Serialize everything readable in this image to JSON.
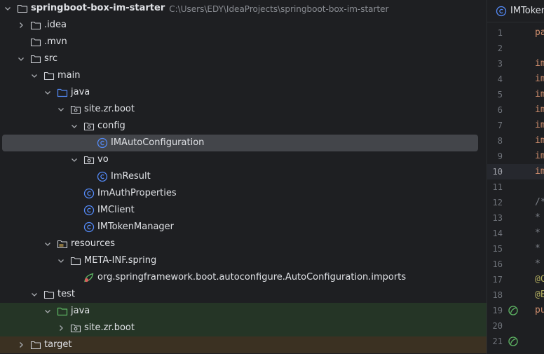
{
  "project_tree": {
    "root_name": "springboot-box-im-starter",
    "root_path": "C:\\Users\\EDY\\IdeaProjects\\springboot-box-im-starter",
    "items": [
      {
        "label": ".idea",
        "icon": "folder-icon"
      },
      {
        "label": ".mvn",
        "icon": "folder-icon"
      },
      {
        "label": "src",
        "icon": "folder-icon"
      },
      {
        "label": "main",
        "icon": "folder-icon"
      },
      {
        "label": "java",
        "icon": "source-folder-icon"
      },
      {
        "label": "site.zr.boot",
        "icon": "package-icon"
      },
      {
        "label": "config",
        "icon": "package-icon"
      },
      {
        "label": "IMAutoConfiguration",
        "icon": "class-icon",
        "selected": true
      },
      {
        "label": "vo",
        "icon": "package-icon"
      },
      {
        "label": "ImResult",
        "icon": "class-icon"
      },
      {
        "label": "ImAuthProperties",
        "icon": "class-icon"
      },
      {
        "label": "IMClient",
        "icon": "class-icon"
      },
      {
        "label": "IMTokenManager",
        "icon": "class-icon"
      },
      {
        "label": "resources",
        "icon": "resources-folder-icon"
      },
      {
        "label": "META-INF.spring",
        "icon": "folder-icon"
      },
      {
        "label": "org.springframework.boot.autoconfigure.AutoConfiguration.imports",
        "icon": "spring-imports-file-icon"
      },
      {
        "label": "test",
        "icon": "folder-icon"
      },
      {
        "label": "java",
        "icon": "test-source-folder-icon"
      },
      {
        "label": "site.zr.boot",
        "icon": "package-icon"
      },
      {
        "label": "target",
        "icon": "folder-icon"
      }
    ]
  },
  "editor": {
    "tab_label": "IMToken",
    "lines": [
      {
        "n": "1",
        "code": "pa",
        "color": "#cf8e6d"
      },
      {
        "n": "2",
        "code": "",
        "color": "#bcbec4"
      },
      {
        "n": "3",
        "code": "im",
        "color": "#cf8e6d"
      },
      {
        "n": "4",
        "code": "im",
        "color": "#cf8e6d"
      },
      {
        "n": "5",
        "code": "im",
        "color": "#cf8e6d"
      },
      {
        "n": "6",
        "code": "im",
        "color": "#cf8e6d"
      },
      {
        "n": "7",
        "code": "im",
        "color": "#cf8e6d"
      },
      {
        "n": "8",
        "code": "im",
        "color": "#cf8e6d"
      },
      {
        "n": "9",
        "code": "im",
        "color": "#cf8e6d"
      },
      {
        "n": "10",
        "code": "im",
        "color": "#cf8e6d",
        "current": true
      },
      {
        "n": "11",
        "code": "",
        "color": "#bcbec4"
      },
      {
        "n": "12",
        "code": "/*",
        "color": "#7a7e85"
      },
      {
        "n": "13",
        "code": " *",
        "color": "#7a7e85"
      },
      {
        "n": "14",
        "code": " *",
        "color": "#7a7e85"
      },
      {
        "n": "15",
        "code": " *",
        "color": "#7a7e85"
      },
      {
        "n": "16",
        "code": " *",
        "color": "#7a7e85"
      },
      {
        "n": "17",
        "code": "@C",
        "color": "#b3ae60"
      },
      {
        "n": "18",
        "code": "@E",
        "color": "#b3ae60"
      },
      {
        "n": "19",
        "code": "pu",
        "color": "#cf8e6d",
        "gutter_icon": "spring-bean-icon"
      },
      {
        "n": "20",
        "code": "",
        "color": "#bcbec4"
      },
      {
        "n": "21",
        "code": "",
        "color": "#bcbec4",
        "gutter_icon": "spring-bean-icon"
      }
    ]
  },
  "colors": {
    "background": "#1e1f22",
    "selection": "#43454a",
    "test_row_bg": "#253526",
    "excluded_row_bg": "#3b3122",
    "class_icon": "#548af7",
    "folder_icon": "#ced0d6"
  }
}
